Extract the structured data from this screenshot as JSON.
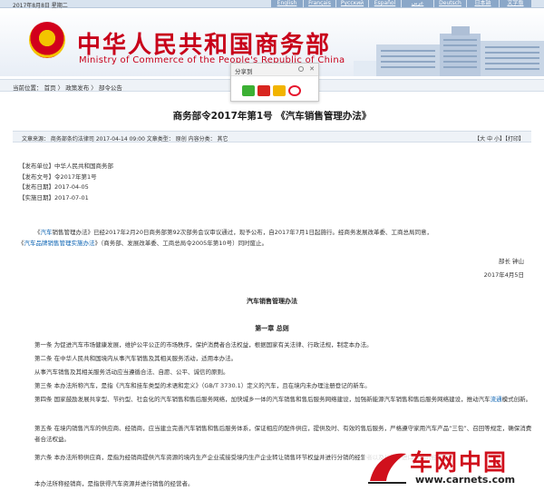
{
  "topbar": {
    "date": "2017年8月8日   星期二",
    "languages": [
      "English",
      "Français",
      "Русский",
      "Español",
      "عربي",
      "Deutsch",
      "日本語",
      "文字版"
    ]
  },
  "header": {
    "title_cn": "中华人民共和国商务部",
    "title_en": "Ministry of Commerce of the People's Republic of China",
    "emblem_icon": "national-emblem-icon",
    "accent_color": "#c8001a"
  },
  "share": {
    "title": "分享到",
    "icons": [
      "wechat-icon",
      "renren-icon",
      "zhihu-icon",
      "weibo-icon"
    ]
  },
  "breadcrumb": {
    "text": "当前位置：  首页  〉 政策发布  〉 部令公告"
  },
  "article": {
    "title": "商务部令2017年第1号 《汽车销售管理办法》",
    "meta_left": "文章来源：  商务部条约法律司        2017-04-14 09:00      文章类型：  原创      内容分类：  其它",
    "meta_right": "【大 中 小】【打印】",
    "info": [
      "【发布单位】中华人民共和国商务部",
      "【发布文号】令2017年第1号",
      "【发布日期】2017-04-05",
      "【实施日期】2017-07-01"
    ],
    "intro_p1_a": "《",
    "intro_p1_link": "汽车",
    "intro_p1_b": "销售管理办法》已经2017年2月20日商务部第92次部务会议审议通过，现予公布，自2017年7月1日起施行。经商务发展改革委、工商总局同意，",
    "intro_p2_a": "《",
    "intro_p2_link": "汽车品牌销售管理实施办法",
    "intro_p2_b": "》（商务部、发展改革委、工商总局令2005年第10号）同时废止。",
    "sign_name": "部长  钟山",
    "sign_date": "2017年4月5日",
    "law_title": "汽车销售管理办法",
    "chapter": "第一章  总则",
    "articles": [
      "第一条  为促进汽车市场健康发展，维护公平公正的市场秩序，保护消费者合法权益，根据国家有关法律、行政法规，制定本办法。",
      "第二条  在中华人民共和国境内从事汽车销售及其相关服务活动，适用本办法。",
      "从事汽车销售及其相关服务活动应当遵循合法、自愿、公平、诚信的原则。",
      "第三条  本办法所称汽车，是指《汽车和挂车类型的术语和定义》（GB/T 3730.1）定义的汽车，且在境内未办理注册登记的新车。",
      "第四条  国家鼓励发展共享型、节约型、社会化的汽车销售和售后服务网络，加快城乡一体的汽车销售和售后服务网络建设，加强新能源汽车销售和售后服务网络建设，推动汽车",
      "第五条  在境内销售汽车的供应商、经销商，应当建立完善汽车销售和售后服务体系，保证相应的配件供应，提供及时、有效的售后服务，严格遵守家用汽车产品“三包”、召回等规定，确保消费者合法权益。",
      "第六条  本办法所称供应商，是指为经销商提供汽车资源的境内生产企业或接受境内生产企业转让销售环节权益并进行分销的经营者以及从境外进口汽车的经营者。",
      "本办法所称经销商，是指获得汽车资源并进行销售的经营者。"
    ],
    "a4_link": "流通",
    "a4_tail": "模式创新。",
    "a6_wrap": "车的经营者。"
  },
  "watermark": {
    "cn": "车网中国",
    "url": "www.carnets.com"
  }
}
